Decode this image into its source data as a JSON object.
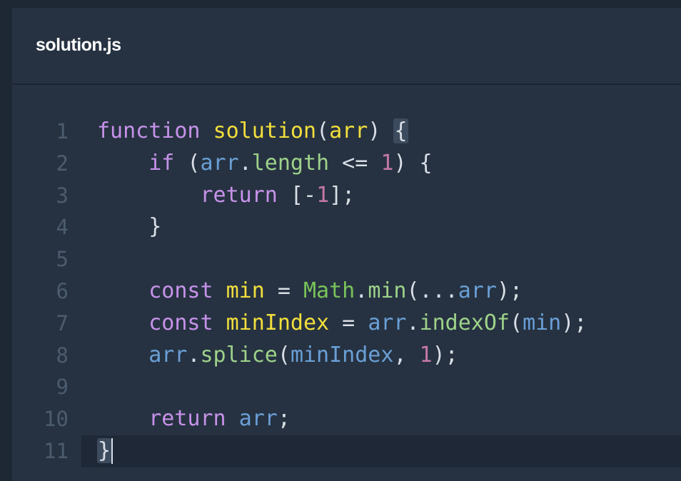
{
  "file": {
    "name": "solution.js"
  },
  "editor": {
    "line_numbers": [
      "1",
      "2",
      "3",
      "4",
      "5",
      "6",
      "7",
      "8",
      "9",
      "10",
      "11"
    ],
    "active_line": 11,
    "colors": {
      "background": "#263241",
      "keyword": "#c792ea",
      "function_name": "#f3df3c",
      "variable": "#6a9fd6",
      "property": "#9ed28a",
      "number": "#c678a6",
      "builtin": "#78c45a",
      "line_number": "#4c5b6e"
    },
    "lines": [
      {
        "tokens": [
          {
            "t": "function",
            "c": "kw"
          },
          {
            "t": " ",
            "c": "punc"
          },
          {
            "t": "solution",
            "c": "fn"
          },
          {
            "t": "(",
            "c": "punc"
          },
          {
            "t": "arr",
            "c": "fn"
          },
          {
            "t": ") ",
            "c": "punc"
          },
          {
            "t": "{",
            "c": "punc bracket-match"
          }
        ]
      },
      {
        "tokens": [
          {
            "t": "    ",
            "c": "punc"
          },
          {
            "t": "if",
            "c": "kw"
          },
          {
            "t": " (",
            "c": "punc"
          },
          {
            "t": "arr",
            "c": "var"
          },
          {
            "t": ".",
            "c": "punc"
          },
          {
            "t": "length",
            "c": "prop"
          },
          {
            "t": " <= ",
            "c": "punc"
          },
          {
            "t": "1",
            "c": "num"
          },
          {
            "t": ") {",
            "c": "punc"
          }
        ]
      },
      {
        "tokens": [
          {
            "t": "        ",
            "c": "punc"
          },
          {
            "t": "return",
            "c": "kw"
          },
          {
            "t": " [-",
            "c": "punc"
          },
          {
            "t": "1",
            "c": "num"
          },
          {
            "t": "];",
            "c": "punc"
          }
        ]
      },
      {
        "tokens": [
          {
            "t": "    }",
            "c": "punc"
          }
        ]
      },
      {
        "tokens": []
      },
      {
        "tokens": [
          {
            "t": "    ",
            "c": "punc"
          },
          {
            "t": "const",
            "c": "kw"
          },
          {
            "t": " ",
            "c": "punc"
          },
          {
            "t": "min",
            "c": "fn"
          },
          {
            "t": " = ",
            "c": "punc"
          },
          {
            "t": "Math",
            "c": "cls"
          },
          {
            "t": ".",
            "c": "punc"
          },
          {
            "t": "min",
            "c": "prop"
          },
          {
            "t": "(...",
            "c": "punc"
          },
          {
            "t": "arr",
            "c": "var"
          },
          {
            "t": ");",
            "c": "punc"
          }
        ]
      },
      {
        "tokens": [
          {
            "t": "    ",
            "c": "punc"
          },
          {
            "t": "const",
            "c": "kw"
          },
          {
            "t": " ",
            "c": "punc"
          },
          {
            "t": "minIndex",
            "c": "fn"
          },
          {
            "t": " = ",
            "c": "punc"
          },
          {
            "t": "arr",
            "c": "var"
          },
          {
            "t": ".",
            "c": "punc"
          },
          {
            "t": "indexOf",
            "c": "prop"
          },
          {
            "t": "(",
            "c": "punc"
          },
          {
            "t": "min",
            "c": "var"
          },
          {
            "t": ");",
            "c": "punc"
          }
        ]
      },
      {
        "tokens": [
          {
            "t": "    ",
            "c": "punc"
          },
          {
            "t": "arr",
            "c": "var"
          },
          {
            "t": ".",
            "c": "punc"
          },
          {
            "t": "splice",
            "c": "prop"
          },
          {
            "t": "(",
            "c": "punc"
          },
          {
            "t": "minIndex",
            "c": "var"
          },
          {
            "t": ", ",
            "c": "punc"
          },
          {
            "t": "1",
            "c": "num"
          },
          {
            "t": ");",
            "c": "punc"
          }
        ]
      },
      {
        "tokens": []
      },
      {
        "tokens": [
          {
            "t": "    ",
            "c": "punc"
          },
          {
            "t": "return",
            "c": "kw"
          },
          {
            "t": " ",
            "c": "punc"
          },
          {
            "t": "arr",
            "c": "var"
          },
          {
            "t": ";",
            "c": "punc"
          }
        ]
      },
      {
        "tokens": [
          {
            "t": "}",
            "c": "punc bracket-match"
          }
        ]
      }
    ]
  }
}
